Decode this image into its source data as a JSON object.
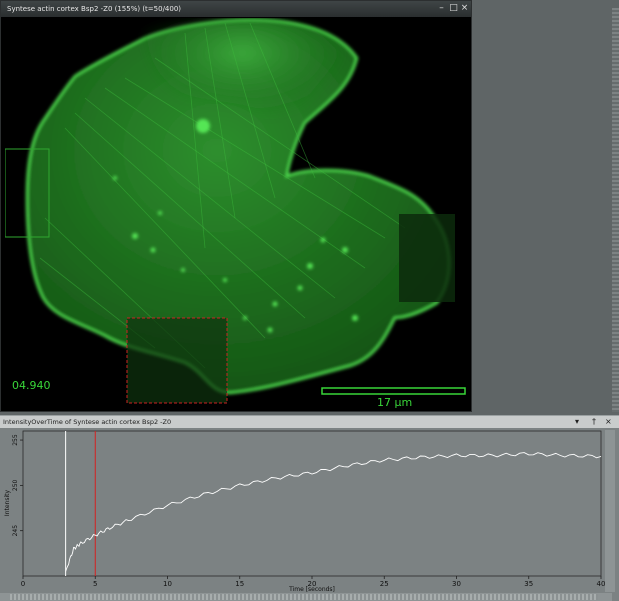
{
  "image_window": {
    "title": "Syntese actin cortex Bsp2 -Z0 (155%) (t=50/400)",
    "timestamp": "04.940",
    "scale_bar_label": "17 μm",
    "controls": {
      "minimize_icon": "minimize-icon",
      "maximize_icon": "maximize-icon",
      "close_icon": "close-icon"
    },
    "colors": {
      "fluorescence": "#33dd33",
      "background": "#000000",
      "roi_bleach": "#cc2222",
      "roi_reference": "#2fa82f"
    }
  },
  "plot_panel": {
    "title": "IntensityOverTime of Syntese actin cortex Bsp2 -Z0",
    "controls": {
      "dropdown_icon": "chevron-down-icon",
      "pin_icon": "pin-icon",
      "close_icon": "close-icon"
    }
  },
  "chart_data": {
    "type": "line",
    "title": "",
    "xlabel": "Time [seconds]",
    "ylabel": "Intensity",
    "xlim": [
      0,
      40
    ],
    "ylim": [
      240,
      256
    ],
    "x_ticks": [
      0,
      5,
      10,
      15,
      20,
      25,
      30,
      35,
      40
    ],
    "y_ticks": [
      245,
      250,
      255
    ],
    "series": [
      {
        "color": "#ffffff",
        "x": [
          2.95,
          3.5,
          4.0,
          5.0,
          6.0,
          7.5,
          10,
          12.5,
          15,
          17.5,
          20,
          22.5,
          25,
          27.5,
          30,
          32.5,
          35,
          37.5,
          40
        ],
        "y": [
          240.5,
          243.0,
          243.6,
          244.5,
          245.3,
          246.3,
          247.8,
          249.0,
          250.0,
          250.8,
          251.4,
          252.2,
          252.8,
          253.1,
          253.3,
          253.3,
          253.5,
          253.3,
          253.2
        ]
      }
    ],
    "markers": [
      {
        "x": 2.95,
        "color": "#ffffff"
      },
      {
        "x": 5.0,
        "color": "#d42020"
      }
    ],
    "grid": false
  }
}
